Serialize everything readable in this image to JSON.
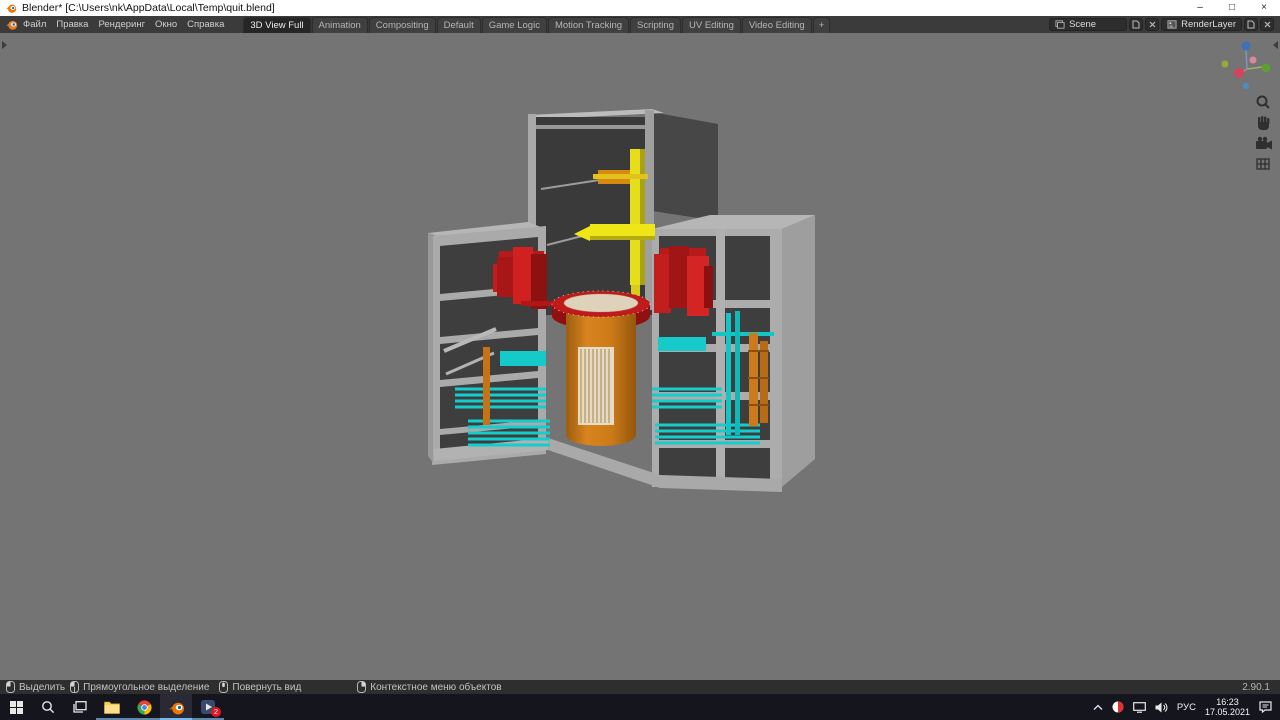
{
  "window": {
    "title": "Blender* [C:\\Users\\nk\\AppData\\Local\\Temp\\quit.blend]",
    "minimize": "–",
    "maximize": "□",
    "close": "×"
  },
  "menubar": {
    "items": [
      "Файл",
      "Правка",
      "Рендеринг",
      "Окно",
      "Справка"
    ]
  },
  "workspace_tabs": {
    "tabs": [
      {
        "label": "3D View Full",
        "active": true
      },
      {
        "label": "Animation",
        "active": false
      },
      {
        "label": "Compositing",
        "active": false
      },
      {
        "label": "Default",
        "active": false
      },
      {
        "label": "Game Logic",
        "active": false
      },
      {
        "label": "Motion Tracking",
        "active": false
      },
      {
        "label": "Scripting",
        "active": false
      },
      {
        "label": "UV Editing",
        "active": false
      },
      {
        "label": "Video Editing",
        "active": false
      }
    ],
    "add_tab": "+"
  },
  "header_right": {
    "scene": "Scene",
    "render_layer": "RenderLayer"
  },
  "statusbar": {
    "select": "Выделить",
    "box_select": "Прямоугольное выделение",
    "rotate_view": "Повернуть вид",
    "context_menu": "Контекстное меню объектов",
    "version": "2.90.1"
  },
  "taskbar": {
    "language": "РУС",
    "time": "16:23",
    "date": "17.05.2021",
    "badge": "2"
  },
  "colors": {
    "viewport_background": "#747474",
    "header_background": "#3b3b3b",
    "reactor_orange": "#d8841f",
    "equipment_red": "#c81e1e",
    "pipes_cyan": "#16caca",
    "crane_yellow": "#ede21e",
    "blender_brand_orange": "#ea7600"
  }
}
